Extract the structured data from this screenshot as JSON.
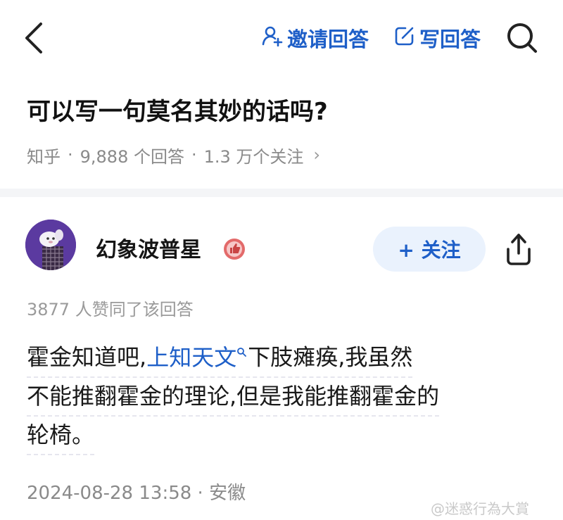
{
  "topbar": {
    "invite_label": "邀请回答",
    "write_label": "写回答"
  },
  "question": {
    "title": "可以写一句莫名其妙的话吗?",
    "source": "知乎",
    "answers": "9,888 个回答",
    "followers": "1.3 万个关注",
    "separator": "·",
    "chevron": "›"
  },
  "author": {
    "name": "幻象波普星",
    "follow_label": "+ 关注"
  },
  "answer": {
    "votes": "3877 人赞同了该回答",
    "line1_pre": "霍金知道吧,",
    "line1_link": "上知天文",
    "line1_post": "下肢瘫痪,我虽然",
    "line2": "不能推翻霍金的理论,但是我能推翻霍金的",
    "line3": "轮椅。",
    "timestamp": "2024-08-28 13:58 · 安徽"
  },
  "watermark": "@迷惑行為大賞",
  "colors": {
    "accent": "#1e5fc8",
    "follow_bg": "#eaf2fd",
    "meta_gray": "#8a8a8a",
    "avatar_bg": "#5b3aa0"
  },
  "icons": [
    "back-arrow-icon",
    "invite-user-icon",
    "edit-icon",
    "search-icon",
    "verified-badge-icon",
    "share-icon",
    "search-link-icon"
  ]
}
